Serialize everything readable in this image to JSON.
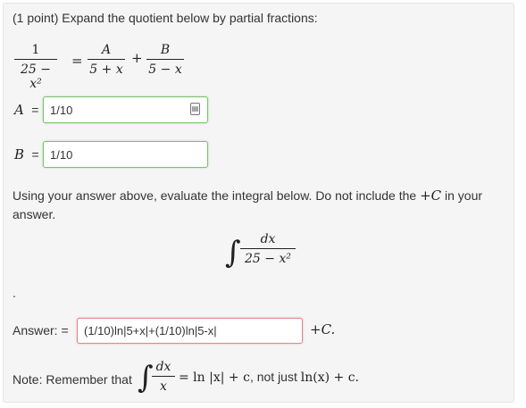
{
  "problem": {
    "prompt": "(1 point) Expand the quotient below by partial fractions:"
  },
  "equation": {
    "lhs_num": "1",
    "lhs_den": "25 − x²",
    "equals": "=",
    "term1_num": "A",
    "term1_den": "5 + x",
    "plus": "+",
    "term2_num": "B",
    "term2_den": "5 − x"
  },
  "field_a": {
    "label_var": "A",
    "label_eq": "=",
    "value": "1/10",
    "icon": "calculator-icon",
    "icon_glyph": "▤"
  },
  "field_b": {
    "label_var": "B",
    "label_eq": "=",
    "value": "1/10"
  },
  "instructions": {
    "line1_pre": "Using your answer above, evaluate the integral below. Do not include the ",
    "line1_math": "+C",
    "line1_post": " in your",
    "line2": "answer."
  },
  "integral": {
    "symbol": "∫",
    "num": "dx",
    "den": "25 − x²"
  },
  "dot": ".",
  "answer": {
    "label": "Answer: =",
    "value": "(1/10)ln|5+x|+(1/10)ln|5-x|",
    "suffix": "+C."
  },
  "note": {
    "prefix": "Note: Remember that",
    "symbol": "∫",
    "num": "dx",
    "den": "x",
    "eq": "= ln |x| + c",
    "mid": ", not just ",
    "wrong": "ln(x) + c",
    "end": "."
  },
  "colors": {
    "panel_bg": "#f5f5f5",
    "correct_border": "#78c36a",
    "incorrect_border": "#e3878a"
  }
}
